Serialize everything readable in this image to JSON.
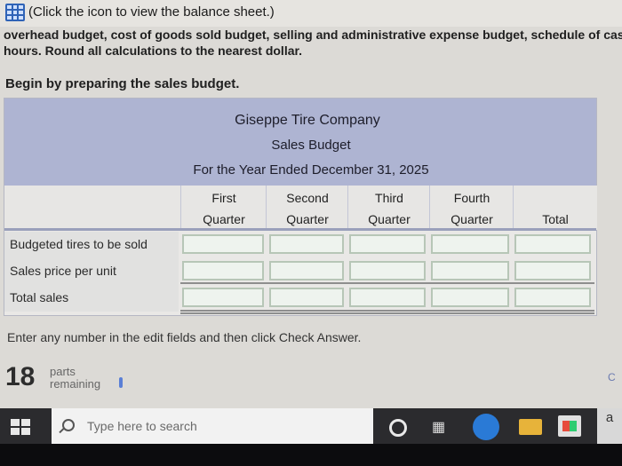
{
  "top": {
    "icon": "spreadsheet-icon",
    "link_text": "(Click the icon to view the balance sheet.)"
  },
  "instructions": {
    "line1": "overhead budget, cost of goods sold budget, selling and administrative expense budget, schedule of cash rec",
    "line2": "hours. Round all calculations to the nearest dollar.",
    "begin": "Begin by preparing the sales budget."
  },
  "budget": {
    "company": "Giseppe Tire Company",
    "name": "Sales Budget",
    "period": "For the Year Ended December 31, 2025",
    "columns": [
      {
        "line1": "First",
        "line2": "Quarter"
      },
      {
        "line1": "Second",
        "line2": "Quarter"
      },
      {
        "line1": "Third",
        "line2": "Quarter"
      },
      {
        "line1": "Fourth",
        "line2": "Quarter"
      },
      {
        "line1": "",
        "line2": "Total"
      }
    ],
    "rows": [
      {
        "label": "Budgeted tires to be sold",
        "values": [
          "",
          "",
          "",
          "",
          ""
        ]
      },
      {
        "label": "Sales price per unit",
        "values": [
          "",
          "",
          "",
          "",
          ""
        ]
      },
      {
        "label": "Total sales",
        "values": [
          "",
          "",
          "",
          "",
          ""
        ]
      }
    ]
  },
  "footer": {
    "hint": "Enter any number in the edit fields and then click Check Answer.",
    "parts_count": "18",
    "parts_label_1": "parts",
    "parts_label_2": "remaining",
    "right_cut": "C"
  },
  "taskbar": {
    "search_placeholder": "Type here to search",
    "app_a": "a"
  }
}
